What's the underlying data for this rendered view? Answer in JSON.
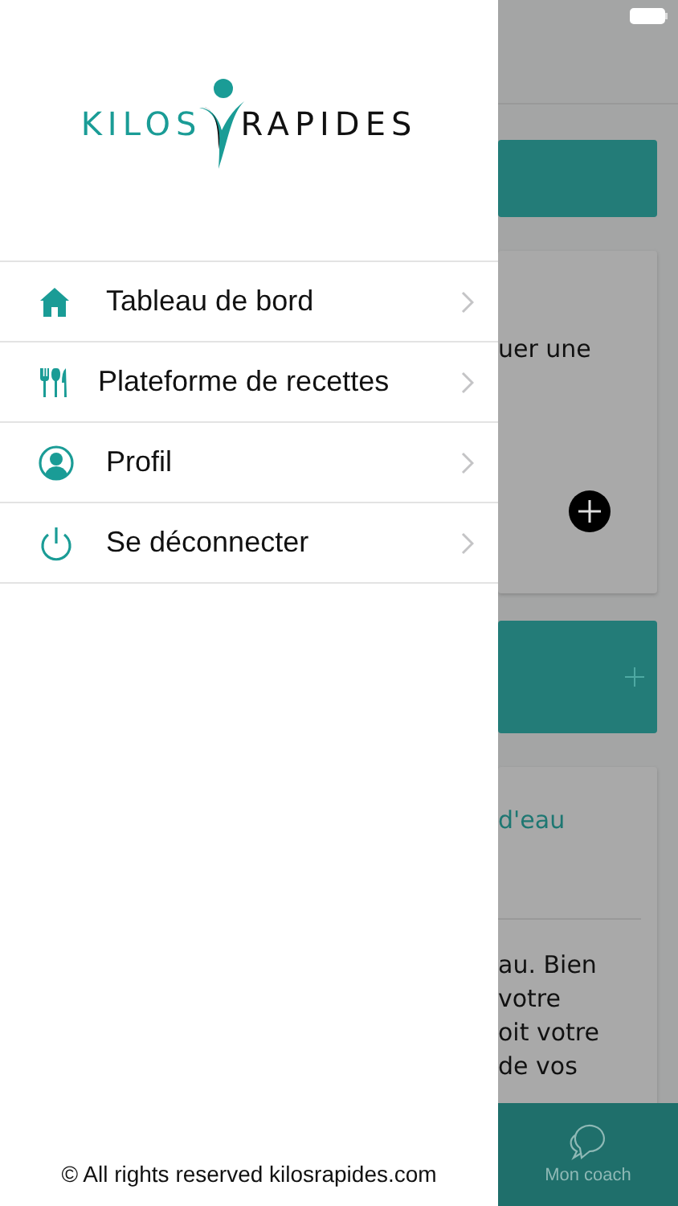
{
  "drawer": {
    "logo": {
      "left_word": "KILOS",
      "right_word": "RAPIDES"
    },
    "menu": [
      {
        "label": "Tableau de bord",
        "kind": "home"
      },
      {
        "label": "Plateforme de recettes",
        "kind": "recipes"
      },
      {
        "label": "Profil",
        "kind": "profile"
      },
      {
        "label": "Se déconnecter",
        "kind": "logout"
      }
    ],
    "footer": "© All rights reserved kilosrapides.com"
  },
  "background": {
    "card_text": "uer une",
    "water_title": "d'eau",
    "water_lines": [
      "au. Bien",
      "votre",
      "oit votre",
      "de vos"
    ],
    "tab": {
      "label": "Mon coach"
    }
  }
}
